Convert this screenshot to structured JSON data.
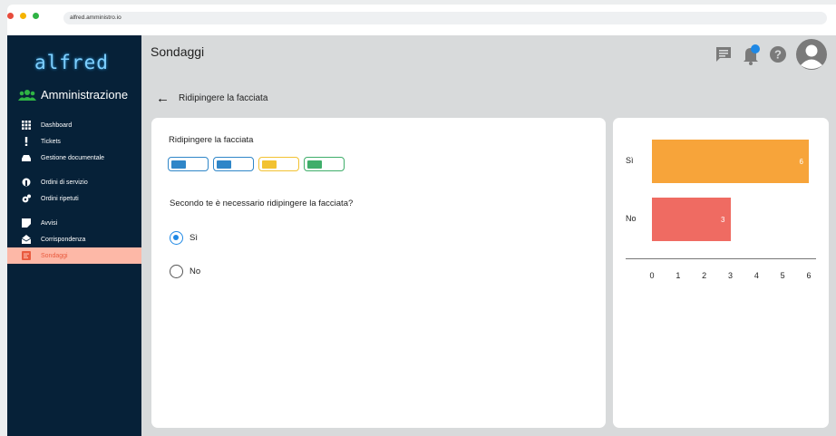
{
  "browser": {
    "url": "alfred.amministro.io",
    "dot_colors": [
      "#e74c3c",
      "#f5b300",
      "#2fb344"
    ]
  },
  "sidebar": {
    "logo": "alfred",
    "section": "Amministrazione",
    "items": [
      {
        "label": "Dashboard",
        "icon": "grid-icon"
      },
      {
        "label": "Tickets",
        "icon": "exclamation-icon"
      },
      {
        "label": "Gestione documentale",
        "icon": "drawer-icon"
      },
      {
        "label": "Ordini di servizio",
        "icon": "wrench-icon"
      },
      {
        "label": "Ordini ripetuti",
        "icon": "cogs-icon"
      },
      {
        "label": "Avvisi",
        "icon": "note-icon"
      },
      {
        "label": "Corrispondenza",
        "icon": "envelope-icon"
      },
      {
        "label": "Sondaggi",
        "icon": "poll-icon",
        "active": true
      }
    ],
    "colors": {
      "bg": "#062138",
      "active_bg": "#fdb8a7",
      "active_text": "#e95b3f"
    }
  },
  "header": {
    "title": "Sondaggi",
    "icons": [
      "message-icon",
      "bell-icon",
      "help-icon",
      "avatar-icon"
    ]
  },
  "breadcrumb": {
    "back_label": "Ridipingere la facciata"
  },
  "poll": {
    "title": "Ridipingere la facciata",
    "tags": [
      {
        "color": "#2f86c8"
      },
      {
        "color": "#2f86c8"
      },
      {
        "color": "#f2c232"
      },
      {
        "color": "#3fae6a"
      }
    ],
    "question": "Secondo te è necessario ridipingere la facciata?",
    "options": [
      {
        "label": "Sì",
        "selected": true
      },
      {
        "label": "No",
        "selected": false
      }
    ]
  },
  "chart_data": {
    "type": "bar",
    "orientation": "horizontal",
    "categories": [
      "Sì",
      "No"
    ],
    "values": [
      6,
      3
    ],
    "colors": [
      "#f7a43a",
      "#ef6b62"
    ],
    "xlim": [
      0,
      6
    ],
    "xticks": [
      "0",
      "1",
      "2",
      "3",
      "4",
      "5",
      "6"
    ],
    "grid": false
  }
}
